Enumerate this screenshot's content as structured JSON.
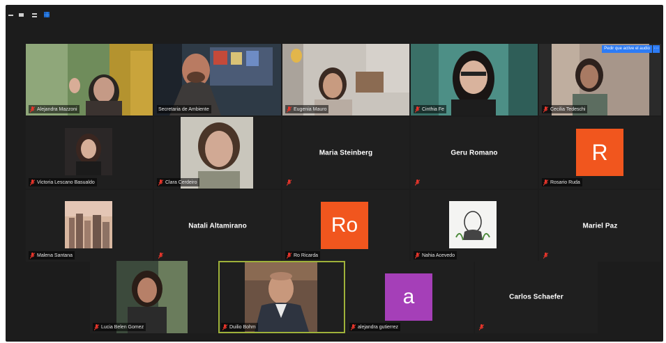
{
  "window_controls": {
    "minimize_icon": "minimize-icon",
    "restore_icon": "restore-icon",
    "speaker_view_icon": "speaker-view-icon",
    "gallery_view_icon": "gallery-view-icon"
  },
  "colors": {
    "background": "#1c1c1c",
    "tile": "#262626",
    "muted_icon": "#e8352b",
    "active_speaker_border": "#9fb23a",
    "avatar_orange": "#f1561e",
    "avatar_purple": "#a53fb8",
    "button_blue": "#2d7cf6"
  },
  "participants": {
    "alejandra_mazzoni": {
      "name": "Alejandra Mazzoni",
      "muted": true
    },
    "secretaria_ambiente": {
      "name": "Secretaria de Ambiente",
      "muted": false
    },
    "eugenia_mauro": {
      "name": "Eugenia Mauro",
      "muted": true
    },
    "cinthia": {
      "name": "Cinthia Fe",
      "muted": true
    },
    "cecilia": {
      "name": "Cecilia Tedeschi",
      "muted": true,
      "request_button": "Pedir que active el audio",
      "more_button": "···"
    },
    "victoria": {
      "name": "Victoria Lescano Basualdo",
      "muted": true
    },
    "clara": {
      "name": "Clara Cerdeiro",
      "muted": true
    },
    "maria_steinberg": {
      "name": "Maria Steinberg",
      "muted": true
    },
    "geru_romano": {
      "name": "Geru Romano",
      "muted": true
    },
    "rosario": {
      "name": "Rosario Ruda",
      "muted": true,
      "avatar_letter": "R"
    },
    "malena": {
      "name": "Malena Santana",
      "muted": true
    },
    "natali": {
      "name": "Natali Altamirano",
      "muted": true
    },
    "ro_ricarda": {
      "name": "Ro Ricarda",
      "muted": true,
      "avatar_letter": "Ro"
    },
    "nahia": {
      "name": "Nahia Acevedo",
      "muted": true
    },
    "mariel": {
      "name": "Mariel Paz",
      "muted": true
    },
    "lucia": {
      "name": "Lucia Belen Gomez",
      "muted": true
    },
    "duilio": {
      "name": "Duilio Bohm",
      "muted": true
    },
    "alejandra_gutierrez": {
      "name": "alejandra gutierrez",
      "muted": true,
      "avatar_letter": "a"
    },
    "carlos": {
      "name": "Carlos Schaefer",
      "muted": true
    }
  }
}
